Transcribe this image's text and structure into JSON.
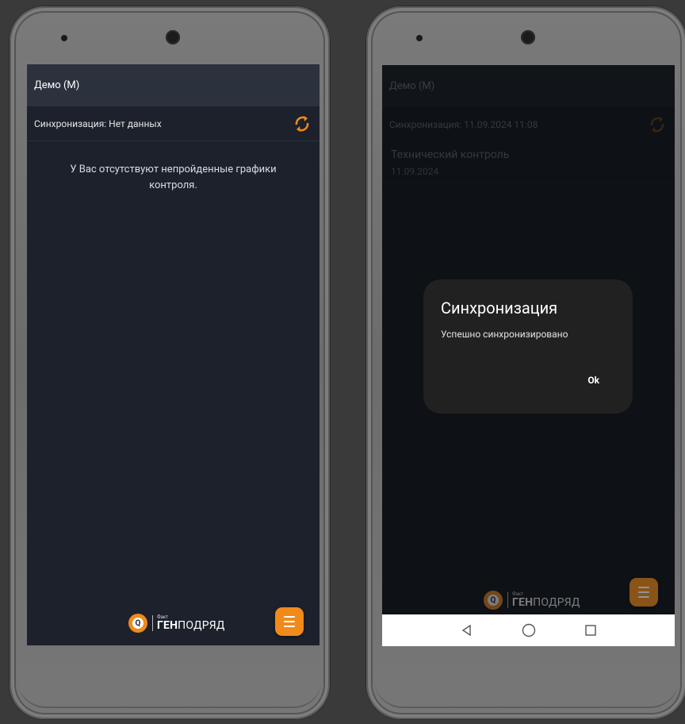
{
  "left_screen": {
    "appbar": {
      "title": "Демо (М)"
    },
    "sync": {
      "label": "Синхронизация: Нет данных",
      "icon": "sync-icon"
    },
    "empty_message": "У Вас отсутствуют непройденные графики контроля.",
    "fab": {
      "icon": "menu-icon"
    },
    "logo": {
      "small": "Факт",
      "big_bold": "ГЕН",
      "big_regular": "ПОДРЯД"
    }
  },
  "right_screen": {
    "appbar": {
      "title": "Демо (М)"
    },
    "sync": {
      "label": "Синхронизация: 11.09.2024 11:08",
      "icon": "sync-icon"
    },
    "list": [
      {
        "title": "Технический контроль",
        "date": "11.09.2024"
      }
    ],
    "dialog": {
      "title": "Синхронизация",
      "message": "Успешно синхронизировано",
      "ok_label": "Ok"
    },
    "fab": {
      "icon": "menu-icon"
    },
    "logo": {
      "small": "Факт",
      "big_bold": "ГЕН",
      "big_regular": "ПОДРЯД"
    },
    "navbar": {
      "icons": [
        "back-icon",
        "home-icon",
        "recents-icon"
      ]
    }
  },
  "colors": {
    "accent": "#f08a1b",
    "appbar": "#2b323d",
    "background": "#1c212b",
    "dialog": "#212121"
  }
}
